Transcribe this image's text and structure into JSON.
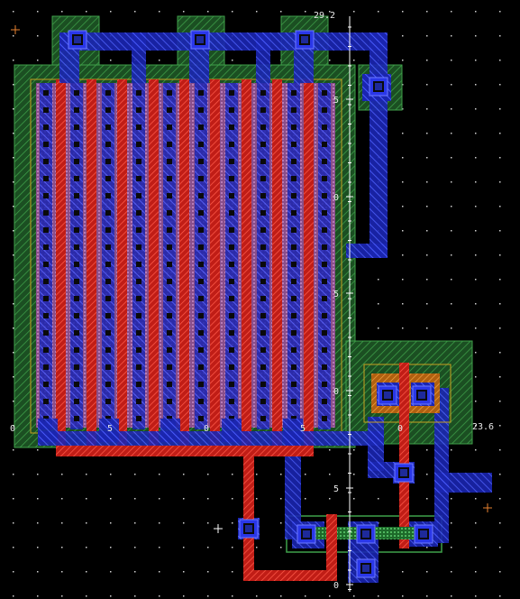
{
  "app": {
    "name": "VLSI layout editor",
    "view": "transistor layout canvas"
  },
  "rulers": {
    "top_coord": "29.2",
    "right_coord": "23.6",
    "vertical_ticks": [
      "5",
      "0",
      "5",
      "0",
      "5",
      "0",
      "5",
      "0"
    ],
    "horizontal_ticks": [
      "0",
      "5",
      "0",
      "5",
      "0",
      "5",
      "0"
    ]
  },
  "colors": {
    "background": "#000000",
    "nwell": "#2f8f3a",
    "pdiff": "#b06ab0",
    "poly": "#e0342a",
    "metal1": "#2a37e8",
    "metal2": "#1f3cc8",
    "contact": "#101010",
    "pplus_select": "#e08a1a",
    "origin_marker": "#e9822f",
    "ruler": "#ffffff"
  },
  "layers": [
    "nwell",
    "pdiff",
    "poly",
    "metal1",
    "contact",
    "select"
  ]
}
